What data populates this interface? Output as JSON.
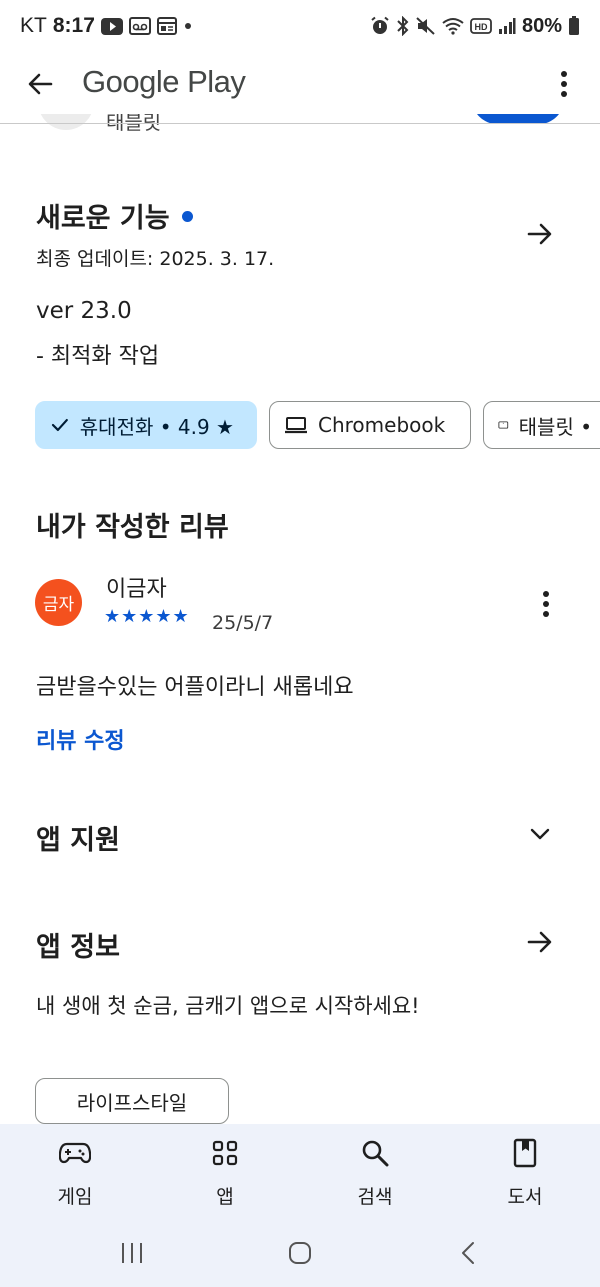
{
  "status_bar": {
    "carrier": "KT",
    "time": "8:17",
    "battery": "80%"
  },
  "app_bar": {
    "title": "Google Play"
  },
  "previous_row": {
    "label": "태블릿"
  },
  "whats_new": {
    "title": "새로운 기능",
    "updated": "최종 업데이트: 2025. 3. 17.",
    "version": "ver 23.0",
    "note": "- 최적화 작업"
  },
  "device_chips": [
    {
      "label": "휴대전화 • 4.9 ★",
      "selected": true
    },
    {
      "label": "Chromebook",
      "selected": false
    },
    {
      "label": "태블릿 •",
      "selected": false
    }
  ],
  "my_review": {
    "title": "내가 작성한 리뷰",
    "avatar_text": "금자",
    "avatar_color": "#f4511e",
    "reviewer": "이금자",
    "rating": 5,
    "stars": "★★★★★",
    "date": "25/5/7",
    "text": "금받을수있는 어플이라니 새롭네요",
    "edit_label": "리뷰 수정"
  },
  "app_support": {
    "title": "앱 지원"
  },
  "about_app": {
    "title": "앱 정보",
    "description": "내 생애 첫 순금, 금캐기 앱으로 시작하세요!",
    "tag": "라이프스타일"
  },
  "bottom_nav": {
    "items": [
      {
        "label": "게임",
        "icon": "gamepad-icon"
      },
      {
        "label": "앱",
        "icon": "apps-grid-icon"
      },
      {
        "label": "검색",
        "icon": "search-icon"
      },
      {
        "label": "도서",
        "icon": "book-icon"
      }
    ]
  },
  "colors": {
    "accent": "#0b57d0",
    "chip_selected": "#c2e7ff",
    "nav_background": "#eef2fa"
  }
}
